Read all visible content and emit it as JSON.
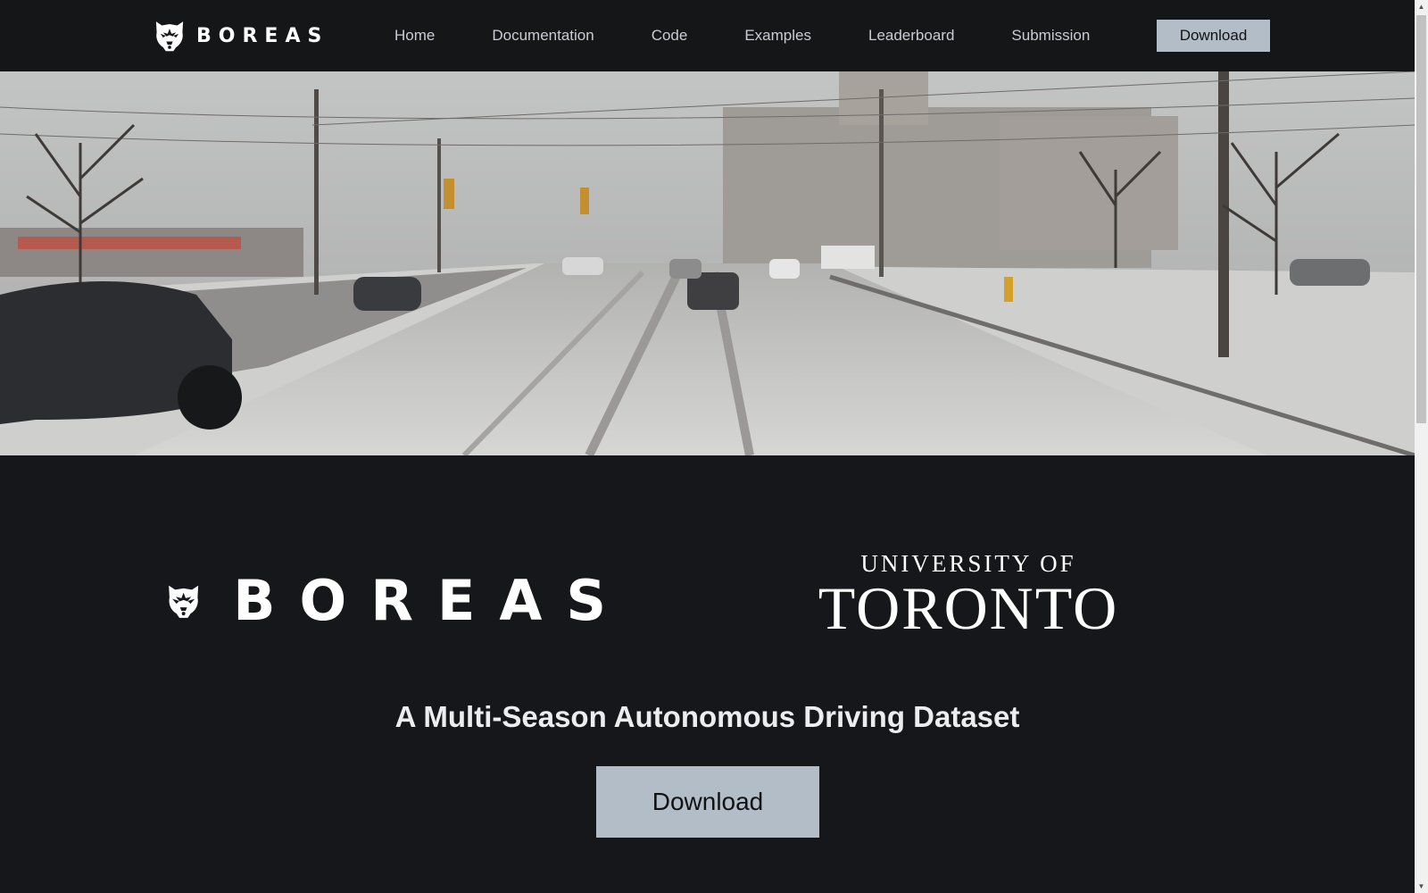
{
  "nav": {
    "brand": "BOREAS",
    "links": [
      "Home",
      "Documentation",
      "Code",
      "Examples",
      "Leaderboard",
      "Submission"
    ],
    "download_label": "Download"
  },
  "hero": {
    "image_description": "snowy-road-scene"
  },
  "logos": {
    "brand": "BOREAS",
    "university_top": "UNIVERSITY OF",
    "university_bottom": "TORONTO"
  },
  "main": {
    "tagline": "A Multi-Season Autonomous Driving Dataset",
    "download_label": "Download"
  },
  "colors": {
    "background": "#16171a",
    "navbar": "#151618",
    "button": "#b3bdc8",
    "nav_link": "#c9cdd3"
  },
  "icons": {
    "brand_logo": "bear-head-icon",
    "scroll_up": "triangle-up-icon",
    "scroll_down": "triangle-down-icon"
  }
}
